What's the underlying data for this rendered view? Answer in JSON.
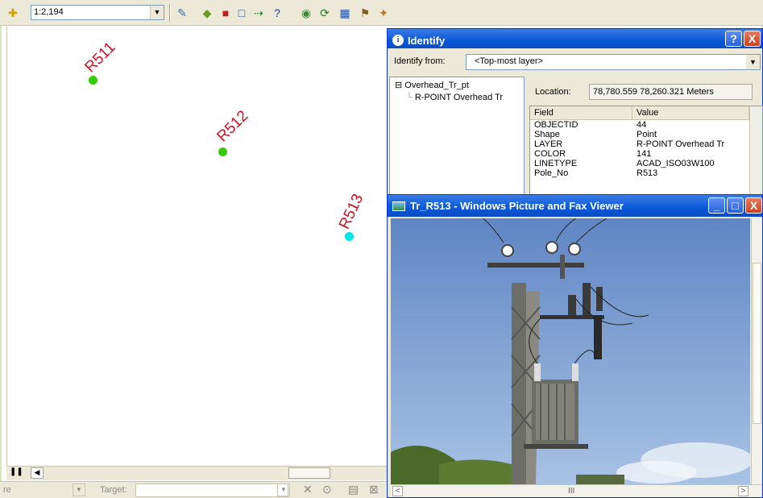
{
  "toolbar": {
    "scale_value": "1:2,194"
  },
  "map": {
    "points": [
      {
        "label": "R511",
        "color": "#33cc00"
      },
      {
        "label": "R512",
        "color": "#33cc00"
      },
      {
        "label": "R513",
        "color": "#00e5e5"
      }
    ]
  },
  "status": {
    "left_text": "re",
    "target_label": "Target:"
  },
  "identify": {
    "title": "Identify",
    "help_btn": "?",
    "close_btn": "X",
    "from_label": "Identify from:",
    "from_value": "<Top-most layer>",
    "tree_root": "Overhead_Tr_pt",
    "tree_child": "R-POINT Overhead Tr",
    "location_label": "Location:",
    "location_value": "78,780.559  78,260.321 Meters",
    "grid_head": {
      "field": "Field",
      "value": "Value"
    },
    "rows": [
      {
        "field": "OBJECTID",
        "value": "44"
      },
      {
        "field": "Shape",
        "value": "Point"
      },
      {
        "field": "LAYER",
        "value": "R-POINT Overhead Tr"
      },
      {
        "field": "COLOR",
        "value": "141"
      },
      {
        "field": "LINETYPE",
        "value": "ACAD_ISO03W100"
      },
      {
        "field": "Pole_No",
        "value": "R513"
      }
    ]
  },
  "viewer": {
    "title": "Tr_R513 - Windows Picture and Fax Viewer",
    "scroll_mark": "III"
  }
}
